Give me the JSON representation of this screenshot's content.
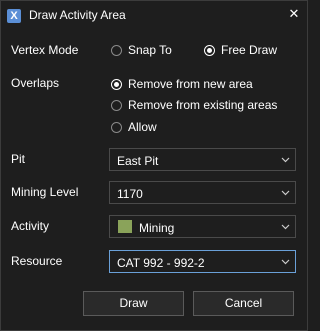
{
  "window": {
    "title": "Draw Activity Area",
    "app_icon_glyph": "X",
    "close_glyph": "✕"
  },
  "vertex_mode": {
    "label": "Vertex Mode",
    "options": [
      {
        "label": "Snap To",
        "selected": false
      },
      {
        "label": "Free Draw",
        "selected": true
      }
    ]
  },
  "overlaps": {
    "label": "Overlaps",
    "options": [
      {
        "label": "Remove from new area",
        "selected": true
      },
      {
        "label": "Remove from existing areas",
        "selected": false
      },
      {
        "label": "Allow",
        "selected": false
      }
    ]
  },
  "pit": {
    "label": "Pit",
    "value": "East Pit"
  },
  "mining_level": {
    "label": "Mining Level",
    "value": "1170"
  },
  "activity": {
    "label": "Activity",
    "value": "Mining",
    "swatch_color": "#8aa35a"
  },
  "resource": {
    "label": "Resource",
    "value": "CAT 992 - 992-2"
  },
  "buttons": {
    "draw": "Draw",
    "cancel": "Cancel"
  },
  "colors": {
    "background": "#1e1e1e",
    "accent": "#6aa0d8",
    "text": "#ffffff"
  }
}
